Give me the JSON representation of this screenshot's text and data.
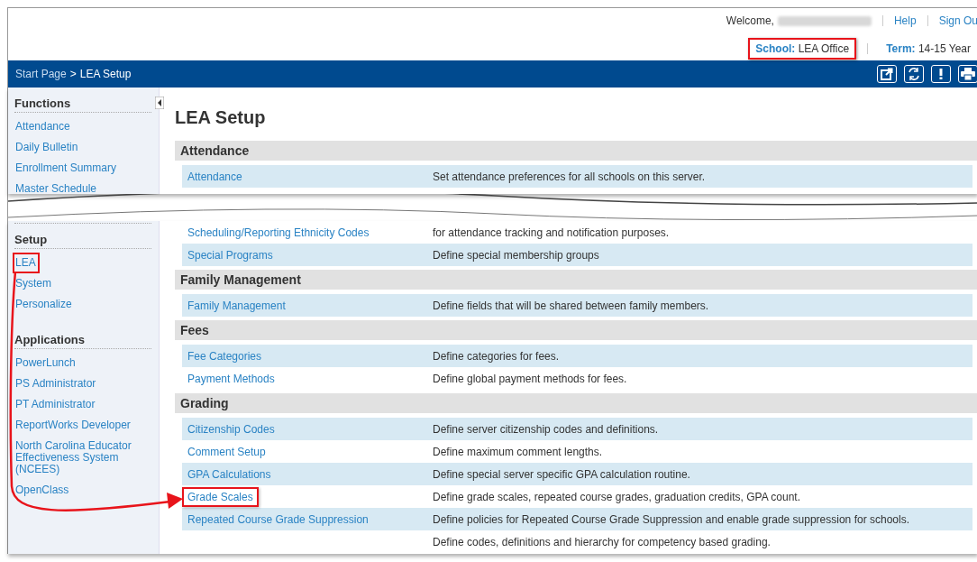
{
  "header": {
    "welcome_label": "Welcome,",
    "links": [
      {
        "label": "Help"
      },
      {
        "label": "Sign Ou"
      }
    ],
    "school": {
      "label": "School:",
      "value": "LEA Office",
      "highlighted": true
    },
    "term": {
      "label": "Term:",
      "value": "14-15 Year"
    }
  },
  "breadcrumb": {
    "link": "Start Page",
    "separator": ">",
    "current": "LEA Setup"
  },
  "sidebar_top": [
    {
      "title": "Functions",
      "items": [
        {
          "label": "Attendance"
        },
        {
          "label": "Daily Bulletin"
        },
        {
          "label": "Enrollment Summary"
        },
        {
          "label": "Master Schedule"
        }
      ]
    }
  ],
  "sidebar_bottom": [
    {
      "title": "Setup",
      "items": [
        {
          "label": "LEA",
          "highlighted": true
        },
        {
          "label": "System"
        },
        {
          "label": "Personalize"
        }
      ]
    },
    {
      "title": "Applications",
      "items": [
        {
          "label": "PowerLunch"
        },
        {
          "label": "PS Administrator"
        },
        {
          "label": "PT Administrator"
        },
        {
          "label": "ReportWorks Developer"
        },
        {
          "label": "North Carolina Educator Effectiveness System (NCEES)"
        },
        {
          "label": "OpenClass"
        }
      ]
    }
  ],
  "page_title": "LEA Setup",
  "sections_top": [
    {
      "title": "Attendance",
      "rows": [
        {
          "link": "Attendance",
          "description": "Set attendance preferences for all schools on this server."
        }
      ]
    }
  ],
  "sections_bottom": [
    {
      "rows": [
        {
          "link": "Scheduling/Reporting Ethnicity Codes",
          "description": "for attendance tracking and notification purposes."
        },
        {
          "link": "Special Programs",
          "description": "Define special membership groups"
        }
      ]
    },
    {
      "title": "Family Management",
      "rows": [
        {
          "link": "Family Management",
          "description": "Define fields that will be shared between family members."
        }
      ]
    },
    {
      "title": "Fees",
      "rows": [
        {
          "link": "Fee Categories",
          "description": "Define categories for fees."
        },
        {
          "link": "Payment Methods",
          "description": "Define global payment methods for fees."
        }
      ]
    },
    {
      "title": "Grading",
      "rows": [
        {
          "link": "Citizenship Codes",
          "description": "Define server citizenship codes and definitions."
        },
        {
          "link": "Comment Setup",
          "description": "Define maximum comment lengths."
        },
        {
          "link": "GPA Calculations",
          "description": "Define special server specific GPA calculation routine."
        },
        {
          "link": "Grade Scales",
          "description": "Define grade scales, repeated course grades, graduation credits, GPA count.",
          "highlighted": true
        },
        {
          "link": "Repeated Course Grade Suppression",
          "description": "Define policies for Repeated Course Grade Suppression and enable grade suppression for schools."
        },
        {
          "description": "Define codes, definitions and hierarchy for competency based grading."
        }
      ]
    }
  ]
}
